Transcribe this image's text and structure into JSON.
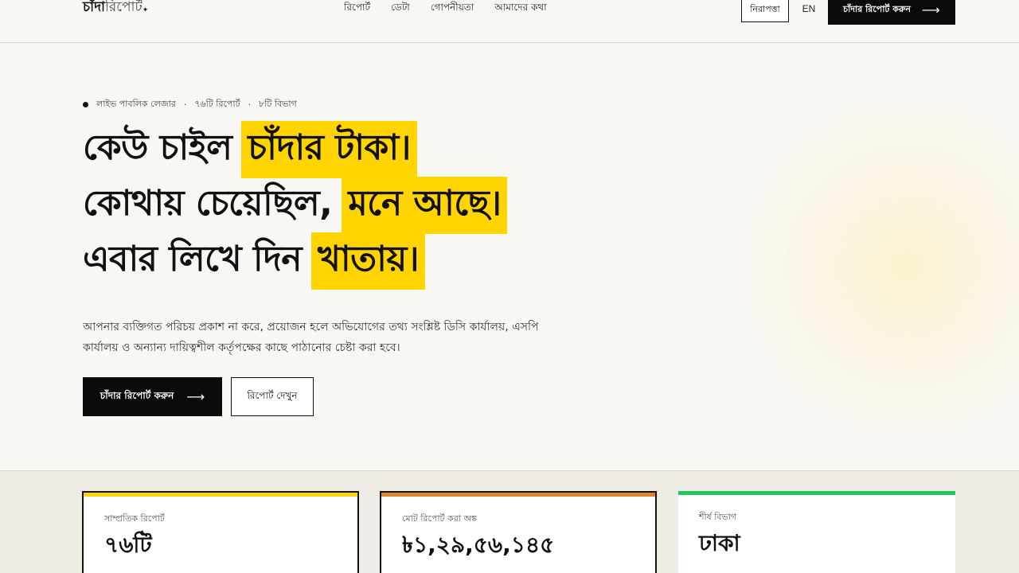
{
  "header": {
    "logo_bold": "চাঁদা",
    "logo_light": "রিপোর্ট",
    "nav": [
      "রিপোর্ট",
      "ডেটা",
      "গোপনীয়তা",
      "আমাদের কথা"
    ],
    "safety_label": "নিরাপত্তা",
    "lang_label": "EN",
    "report_button": "চাঁদার রিপোর্ট করুন"
  },
  "hero": {
    "eyebrow": [
      "লাইভ পাবলিক লেজার",
      "৭৬টি রিপোর্ট",
      "৮টি বিভাগ"
    ],
    "headline": {
      "line1_plain": "কেউ চাইল",
      "line1_mark": "চাঁদার টাকা।",
      "line2_plain": "কোথায় চেয়েছিল,",
      "line2_mark": "মনে আছে।",
      "line3_plain": "এবার লিখে দিন",
      "line3_mark": "খাতায়।"
    },
    "subtext": "আপনার ব্যক্তিগত পরিচয় প্রকাশ না করে, প্রয়োজন হলে অভিযোগের তথ্য সংশ্লিষ্ট ডিসি কার্যালয়, এসপি কার্যালয় ও অন্যান্য দায়িত্বশীল কর্তৃপক্ষের কাছে পাঠানোর চেষ্টা করা হবে।",
    "primary_button": "চাঁদার রিপোর্ট করুন",
    "secondary_button": "রিপোর্ট দেখুন"
  },
  "stats": [
    {
      "label": "সাম্প্রতিক রিপোর্ট",
      "value": "৭৬টি",
      "accent": "#ffd400"
    },
    {
      "label": "মোট রিপোর্ট করা অঙ্ক",
      "value": "৳১,২৯,৫৬,১৪৫",
      "accent": "#e0862f"
    },
    {
      "label": "শীর্ষ বিভাগ",
      "value": "ঢাকা",
      "accent": "#22c55e"
    }
  ],
  "colors": {
    "highlight": "#ffd400",
    "dark": "#0b0b0b",
    "background": "#f8f7f3",
    "stats_background": "#eeece5"
  },
  "icons": {
    "arrow": "arrow-right-icon",
    "logo_mark": "sparkle-icon"
  }
}
